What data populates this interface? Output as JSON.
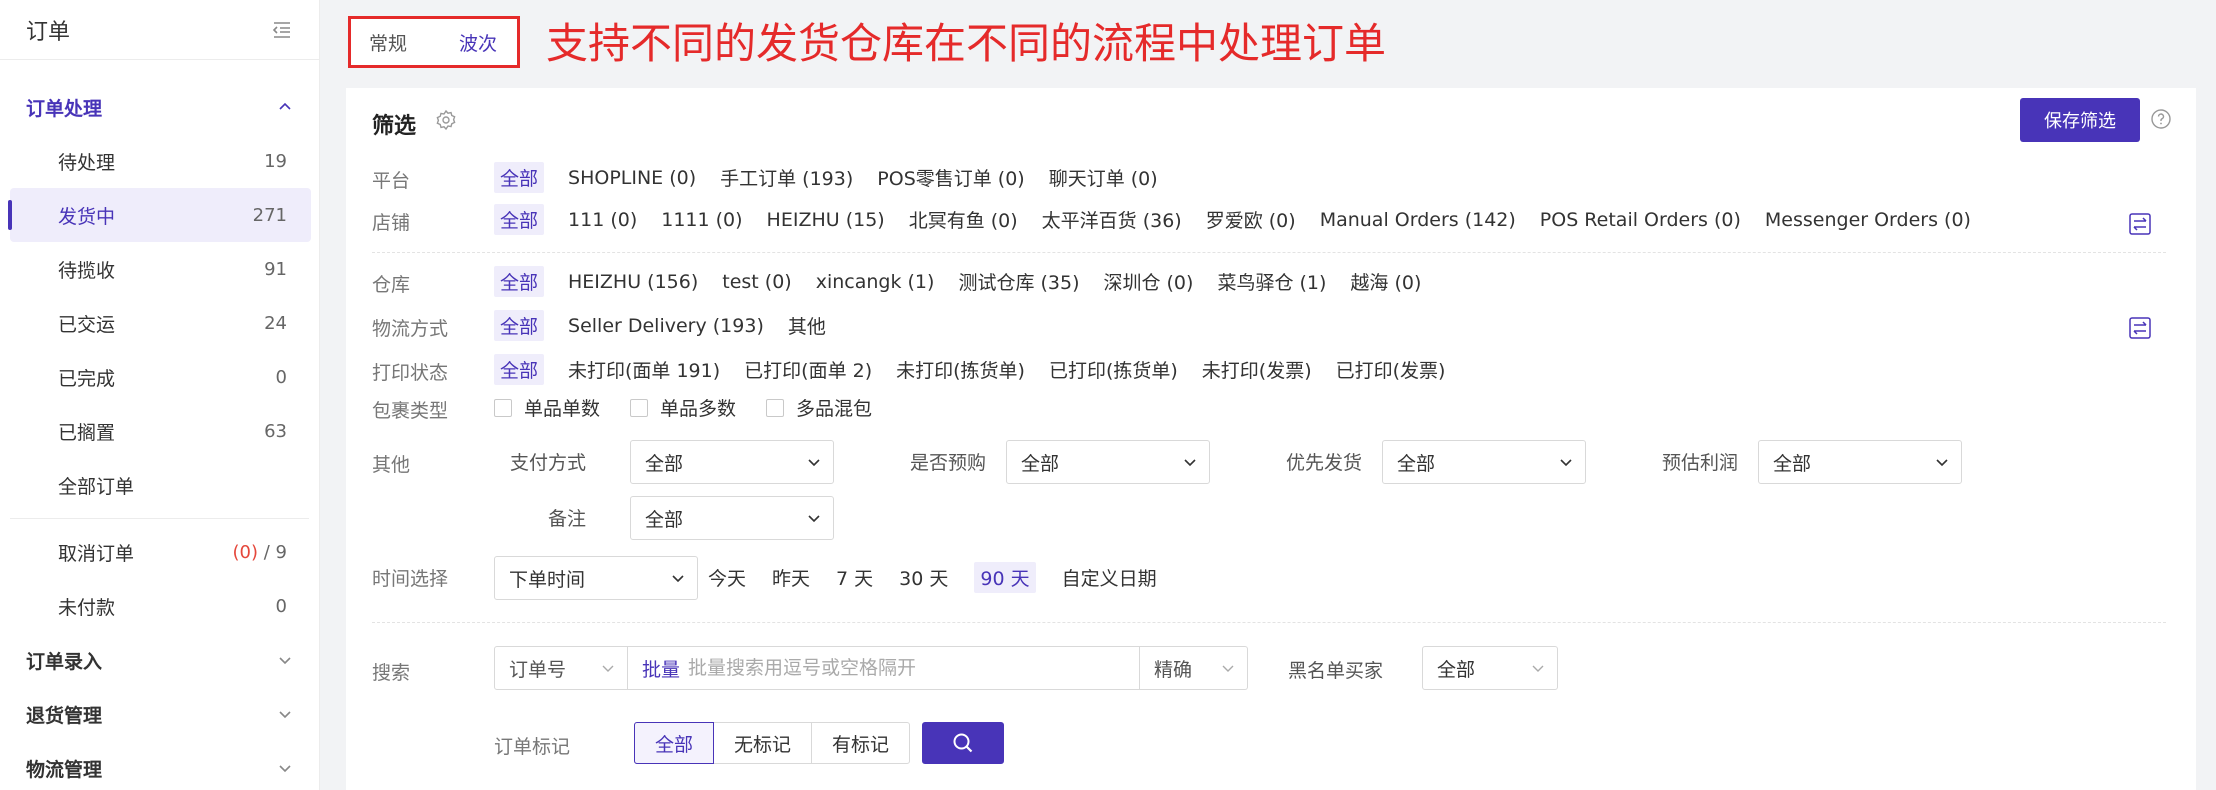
{
  "sidebar": {
    "title": "订单",
    "groups": [
      {
        "label": "订单处理"
      },
      {
        "label": "订单录入"
      },
      {
        "label": "退货管理"
      },
      {
        "label": "物流管理"
      }
    ],
    "items": [
      {
        "label": "待处理",
        "count": "19"
      },
      {
        "label": "发货中",
        "count": "271"
      },
      {
        "label": "待揽收",
        "count": "91"
      },
      {
        "label": "已交运",
        "count": "24"
      },
      {
        "label": "已完成",
        "count": "0"
      },
      {
        "label": "已搁置",
        "count": "63"
      },
      {
        "label": "全部订单",
        "count": ""
      }
    ],
    "cancel": {
      "label": "取消订单",
      "count_red": "(0)",
      "count_rest": " / 9"
    },
    "unpaid": {
      "label": "未付款",
      "count": "0"
    }
  },
  "topbar": {
    "tab1": "常规",
    "tab2": "波次"
  },
  "annotation": "支持不同的发货仓库在不同的流程中处理订单",
  "filter": {
    "title": "筛选",
    "save_label": "保存筛选",
    "platform": {
      "label": "平台",
      "options": [
        "全部",
        "SHOPLINE (0)",
        "手工订单 (193)",
        "POS零售订单 (0)",
        "聊天订单 (0)"
      ]
    },
    "shop": {
      "label": "店铺",
      "options": [
        "全部",
        "111 (0)",
        "1111 (0)",
        "HEIZHU (15)",
        "北冥有鱼 (0)",
        "太平洋百货 (36)",
        "罗爱欧 (0)",
        "Manual Orders (142)",
        "POS Retail Orders (0)",
        "Messenger Orders (0)"
      ]
    },
    "warehouse": {
      "label": "仓库",
      "options": [
        "全部",
        "HEIZHU (156)",
        "test (0)",
        "xincangk (1)",
        "测试仓库 (35)",
        "深圳仓 (0)",
        "菜鸟驿仓 (1)",
        "越海 (0)"
      ]
    },
    "logistics": {
      "label": "物流方式",
      "options": [
        "全部",
        "Seller Delivery (193)",
        "其他"
      ]
    },
    "print": {
      "label": "打印状态",
      "options": [
        "全部",
        "未打印(面单 191)",
        "已打印(面单 2)",
        "未打印(拣货单)",
        "已打印(拣货单)",
        "未打印(发票)",
        "已打印(发票)"
      ]
    },
    "package": {
      "label": "包裹类型",
      "options": [
        "单品单数",
        "单品多数",
        "多品混包"
      ]
    },
    "other": {
      "label": "其他",
      "fields": [
        {
          "label": "支付方式",
          "value": "全部"
        },
        {
          "label": "是否预购",
          "value": "全部"
        },
        {
          "label": "优先发货",
          "value": "全部"
        },
        {
          "label": "预估利润",
          "value": "全部"
        },
        {
          "label": "备注",
          "value": "全部"
        }
      ]
    },
    "time": {
      "label": "时间选择",
      "type": "下单时间",
      "options": [
        "今天",
        "昨天",
        "7 天",
        "30 天",
        "90 天",
        "自定义日期"
      ]
    }
  },
  "search": {
    "label": "搜索",
    "field": "订单号",
    "batch": "批量",
    "placeholder": "批量搜索用逗号或空格隔开",
    "mode": "精确",
    "blacklist_label": "黑名单买家",
    "blacklist_value": "全部",
    "mark_label": "订单标记",
    "marks": [
      "全部",
      "无标记",
      "有标记"
    ]
  }
}
